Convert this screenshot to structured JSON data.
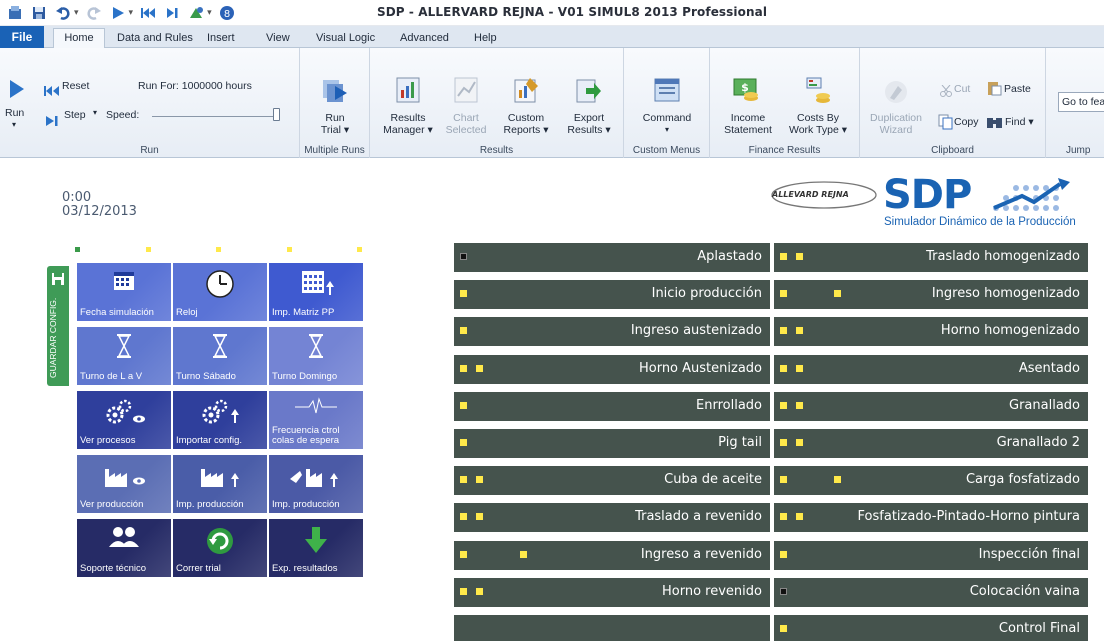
{
  "window": {
    "title": "SDP - ALLERVARD REJNA - V01  SIMUL8 2013 Professional"
  },
  "tabs": [
    "File",
    "Home",
    "Data and Rules",
    "Insert",
    "View",
    "Visual Logic",
    "Advanced",
    "Help"
  ],
  "ribbon": {
    "run_group": {
      "label": "Run",
      "run_button": "Run",
      "reset": "Reset",
      "step": "Step",
      "speed": "Speed:",
      "run_for": "Run For: 1000000 hours"
    },
    "multiple_runs": {
      "label": "Multiple Runs",
      "run_trial_1": "Run",
      "run_trial_2": "Trial"
    },
    "results": {
      "label": "Results",
      "manager_1": "Results",
      "manager_2": "Manager",
      "chart_1": "Chart",
      "chart_2": "Selected",
      "custom_1": "Custom",
      "custom_2": "Reports",
      "export_1": "Export",
      "export_2": "Results"
    },
    "custom_menus": {
      "label": "Custom Menus",
      "command": "Command"
    },
    "finance": {
      "label": "Finance Results",
      "income_1": "Income",
      "income_2": "Statement",
      "costs_1": "Costs By",
      "costs_2": "Work Type"
    },
    "clipboard": {
      "label": "Clipboard",
      "dup_1": "Duplication",
      "dup_2": "Wizard",
      "cut": "Cut",
      "copy": "Copy",
      "paste": "Paste",
      "find": "Find"
    },
    "jump": {
      "label": "Jump",
      "goto": "Go to fea"
    }
  },
  "clock": {
    "time": "0:00",
    "date": "03/12/2013"
  },
  "logo": {
    "company": "ALLEVARD REJNA",
    "brand": "SDP",
    "subtitle": "Simulador Dinámico de la Producción"
  },
  "side_tab": {
    "label": "GUARDAR CONFIG."
  },
  "tiles": [
    {
      "label": "Fecha simulación",
      "icon": "calendar-icon",
      "color": "#5a73d6"
    },
    {
      "label": "Reloj",
      "icon": "clock-icon",
      "color": "#5a73d6"
    },
    {
      "label": "Imp. Matriz PP",
      "icon": "import-matrix-icon",
      "color": "#3f5ad0"
    },
    {
      "label": "Turno de L a V",
      "icon": "hourglass-icon",
      "color": "#5f77cf"
    },
    {
      "label": "Turno Sábado",
      "icon": "hourglass-icon",
      "color": "#5f77cf"
    },
    {
      "label": "Turno Domingo",
      "icon": "hourglass-icon",
      "color": "#7484d4"
    },
    {
      "label": "Ver procesos",
      "icon": "gears-eye-icon",
      "color": "#2f3f9c"
    },
    {
      "label": "Importar config.",
      "icon": "gears-import-icon",
      "color": "#2f3f9c"
    },
    {
      "label": "Frecuencia ctrol colas de espera",
      "icon": "pulse-icon",
      "color": "#6a79c9"
    },
    {
      "label": "Ver producción",
      "icon": "factory-eye-icon",
      "color": "#5b6eb4"
    },
    {
      "label": "Imp. producción",
      "icon": "factory-import-icon",
      "color": "#4a5da8"
    },
    {
      "label": "Imp. producción",
      "icon": "factory-import-icon",
      "color": "#4b5aa6"
    },
    {
      "label": "Soporte técnico",
      "icon": "users-icon",
      "color": "#262b66"
    },
    {
      "label": "Correr trial",
      "icon": "refresh-icon",
      "color": "#262b66"
    },
    {
      "label": "Exp. resultados",
      "icon": "export-down-icon",
      "color": "#262b66"
    }
  ],
  "left_column": [
    {
      "label": "Aplastado",
      "squares": [
        "dark"
      ]
    },
    {
      "label": "Inicio producción",
      "squares": [
        "yellow"
      ]
    },
    {
      "label": "Ingreso austenizado",
      "squares": [
        "yellow"
      ]
    },
    {
      "label": "Horno Austenizado",
      "squares": [
        "yellow",
        "yellow"
      ]
    },
    {
      "label": "Enrrollado",
      "squares": [
        "yellow"
      ]
    },
    {
      "label": "Pig tail",
      "squares": [
        "yellow"
      ]
    },
    {
      "label": "Cuba de aceite",
      "squares": [
        "yellow",
        "yellow"
      ]
    },
    {
      "label": "Traslado a revenido",
      "squares": [
        "yellow",
        "yellow"
      ]
    },
    {
      "label": "Ingreso a revenido",
      "squares": [
        "yellow",
        "yellow-far"
      ]
    },
    {
      "label": "Horno revenido",
      "squares": [
        "yellow",
        "yellow"
      ]
    },
    {
      "label": "",
      "squares": []
    }
  ],
  "right_column": [
    {
      "label": "Traslado homogenizado",
      "squares": [
        "yellow",
        "yellow"
      ]
    },
    {
      "label": "Ingreso homogenizado",
      "squares": [
        "yellow",
        "yellow-far"
      ]
    },
    {
      "label": "Horno homogenizado",
      "squares": [
        "yellow",
        "yellow"
      ]
    },
    {
      "label": "Asentado",
      "squares": [
        "yellow",
        "yellow"
      ]
    },
    {
      "label": "Granallado",
      "squares": [
        "yellow",
        "yellow"
      ]
    },
    {
      "label": "Granallado 2",
      "squares": [
        "yellow",
        "yellow"
      ]
    },
    {
      "label": "Carga fosfatizado",
      "squares": [
        "yellow",
        "yellow-far"
      ]
    },
    {
      "label": "Fosfatizado-Pintado-Horno pintura",
      "squares": [
        "yellow",
        "yellow"
      ]
    },
    {
      "label": "Inspección final",
      "squares": [
        "yellow"
      ]
    },
    {
      "label": "Colocación vaina",
      "squares": [
        "dark"
      ]
    },
    {
      "label": "Control Final",
      "squares": [
        "yellow"
      ]
    }
  ],
  "colors": {
    "bar": "#45534d",
    "indicator": "#ffe94a",
    "brand": "#1a63b3",
    "side_tab": "#3f9b57"
  }
}
